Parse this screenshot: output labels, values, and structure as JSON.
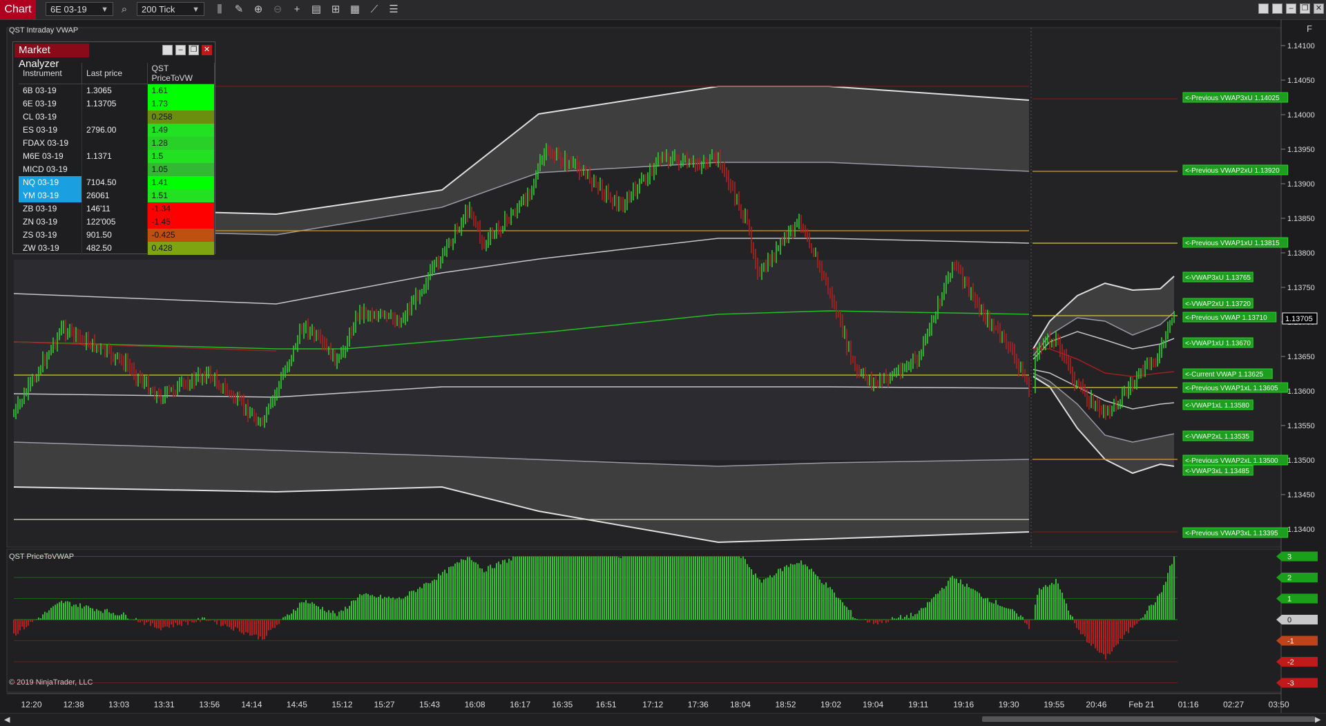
{
  "toolbar": {
    "chart_tab": "Chart",
    "instrument": "6E 03-19",
    "interval": "200 Tick"
  },
  "indicator_label": "QST Intraday VWAP",
  "sub_indicator_label": "QST PriceToVWAP",
  "copyright": "© 2019 NinjaTrader, LLC",
  "f_button": "F",
  "market_analyzer": {
    "title": "Market Analyzer",
    "headers": [
      "Instrument",
      "Last price",
      "QST PriceToVW"
    ],
    "rows": [
      {
        "instrument": "6B 03-19",
        "last": "1.3065",
        "value": "1.61",
        "color": "#00ff00",
        "highlight": false
      },
      {
        "instrument": "6E 03-19",
        "last": "1.13705",
        "value": "1.73",
        "color": "#00ff00",
        "highlight": false
      },
      {
        "instrument": "CL 03-19",
        "last": "",
        "value": "0.258",
        "color": "#6b8e0f",
        "highlight": false
      },
      {
        "instrument": "ES 03-19",
        "last": "2796.00",
        "value": "1.49",
        "color": "#22e022",
        "highlight": false
      },
      {
        "instrument": "FDAX 03-19",
        "last": "",
        "value": "1.28",
        "color": "#28d028",
        "highlight": false
      },
      {
        "instrument": "M6E 03-19",
        "last": "1.1371",
        "value": "1.5",
        "color": "#22e022",
        "highlight": false
      },
      {
        "instrument": "MICD 03-19",
        "last": "",
        "value": "1.05",
        "color": "#32b832",
        "highlight": false
      },
      {
        "instrument": "NQ 03-19",
        "last": "7104.50",
        "value": "1.41",
        "color": "#00ff00",
        "highlight": true
      },
      {
        "instrument": "YM 03-19",
        "last": "26061",
        "value": "1.51",
        "color": "#22e022",
        "highlight": true
      },
      {
        "instrument": "ZB 03-19",
        "last": "146'11",
        "value": "-1.34",
        "color": "#ff0000",
        "highlight": false
      },
      {
        "instrument": "ZN 03-19",
        "last": "122'005",
        "value": "-1.45",
        "color": "#ff0000",
        "highlight": false
      },
      {
        "instrument": "ZS 03-19",
        "last": "901.50",
        "value": "-0.425",
        "color": "#c05010",
        "highlight": false
      },
      {
        "instrument": "ZW 03-19",
        "last": "482.50",
        "value": "0.428",
        "color": "#7ea50f",
        "highlight": false
      }
    ]
  },
  "price_axis": {
    "labels": [
      "1.14100",
      "1.14050",
      "1.14000",
      "1.13950",
      "1.13900",
      "1.13850",
      "1.13800",
      "1.13750",
      "1.13700",
      "1.13650",
      "1.13600",
      "1.13550",
      "1.13500",
      "1.13450",
      "1.13400"
    ],
    "current_price": "1.13705"
  },
  "level_tags": [
    {
      "text": "<-Previous VWAP3xU 1.14025",
      "price": 1.14025
    },
    {
      "text": "<-Previous VWAP2xU 1.13920",
      "price": 1.1392
    },
    {
      "text": "<-Previous VWAP1xU 1.13815",
      "price": 1.13815
    },
    {
      "text": "<-VWAP3xU 1.13765",
      "price": 1.13765
    },
    {
      "text": "<-VWAP2xU 1.13720",
      "price": 1.1372
    },
    {
      "text": "<-Previous VWAP 1.13710",
      "price": 1.1371
    },
    {
      "text": "<-VWAP1xU 1.13670",
      "price": 1.1367
    },
    {
      "text": "<-Current VWAP 1.13625",
      "price": 1.13625
    },
    {
      "text": "<-Previous VWAP1xL 1.13605",
      "price": 1.13605
    },
    {
      "text": "<-VWAP1xL 1.13580",
      "price": 1.1358
    },
    {
      "text": "<-VWAP2xL 1.13535",
      "price": 1.13535
    },
    {
      "text": "<-Previous VWAP2xL 1.13500",
      "price": 1.135
    },
    {
      "text": "<-VWAP3xL 1.13485",
      "price": 1.13485
    },
    {
      "text": "<-Previous VWAP3xL 1.13395",
      "price": 1.13395
    }
  ],
  "osc_axis": {
    "labels": [
      "3",
      "2",
      "1",
      "0",
      "-1",
      "-2",
      "-3"
    ],
    "colors": [
      "#1aa01a",
      "#1aa01a",
      "#1aa01a",
      "#c8c8c8",
      "#c0421a",
      "#c01a1a",
      "#c01a1a"
    ]
  },
  "time_axis": {
    "labels": [
      "12:20",
      "12:38",
      "13:03",
      "13:31",
      "13:56",
      "14:14",
      "14:45",
      "15:12",
      "15:27",
      "15:43",
      "16:08",
      "16:17",
      "16:35",
      "16:51",
      "17:12",
      "17:36",
      "18:04",
      "18:52",
      "19:02",
      "19:04",
      "19:11",
      "19:16",
      "19:30",
      "19:55",
      "20:46",
      "Feb 21",
      "01:16",
      "02:27",
      "03:50"
    ]
  },
  "colors": {
    "up": "#2ecc2e",
    "down": "#b02020",
    "vwap": "#22c022",
    "prev_level_gold": "#d8a020",
    "prev_level_yellow": "#d8d020",
    "tag_bg": "#1e9e1e"
  }
}
